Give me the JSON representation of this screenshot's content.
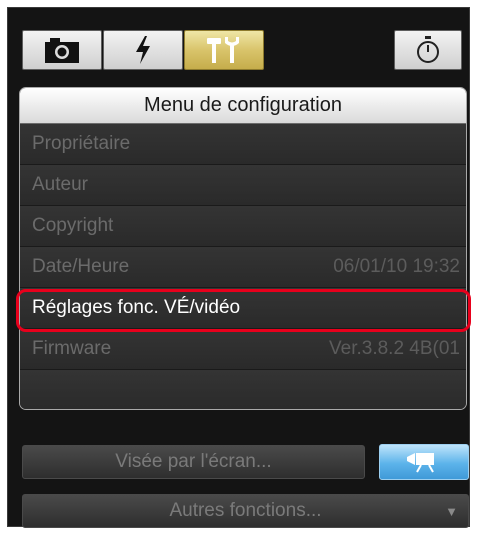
{
  "tabs": [
    {
      "name": "camera",
      "icon": "camera-icon"
    },
    {
      "name": "flash",
      "icon": "flash-icon"
    },
    {
      "name": "setup",
      "icon": "tools-icon",
      "selected": true
    },
    {
      "name": "timer",
      "icon": "stopwatch-icon"
    }
  ],
  "menu": {
    "title": "Menu de configuration",
    "items": [
      {
        "label": "Propriétaire",
        "value": ""
      },
      {
        "label": "Auteur",
        "value": ""
      },
      {
        "label": "Copyright",
        "value": ""
      },
      {
        "label": "Date/Heure",
        "value": "06/01/10  19:32"
      },
      {
        "label": "Réglages fonc. VÉ/vidéo",
        "value": "",
        "highlighted": true
      },
      {
        "label": "Firmware",
        "value": "Ver.3.8.2 4B(01"
      }
    ]
  },
  "buttons": {
    "live_view": "Visée par l'écran...",
    "movie_icon": "movie-camera-icon",
    "other_functions": "Autres fonctions...",
    "other_arrow": "▼"
  },
  "colors": {
    "highlight_border": "#e8001c",
    "active_tab": "#d9c46b",
    "movie_button": "#5cb3ea"
  }
}
